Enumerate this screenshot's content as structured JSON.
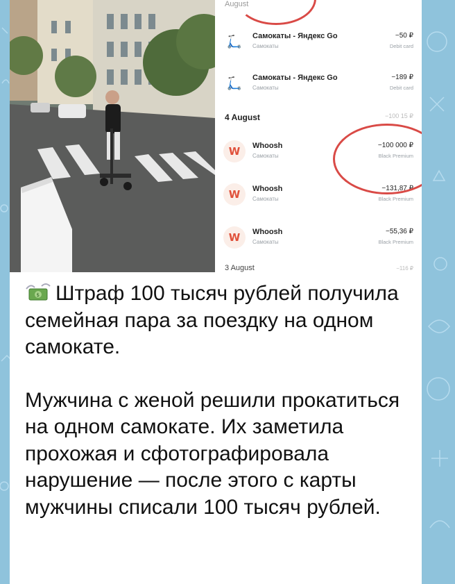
{
  "transactions_screenshot": {
    "header_faded": "August",
    "rows": [
      {
        "merchant": "Самокаты - Яндекс Go",
        "category": "Самокаты",
        "amount": "−50 ₽",
        "card": "Debit card",
        "logo": "yandex-scooter-icon"
      },
      {
        "merchant": "Самокаты - Яндекс Go",
        "category": "Самокаты",
        "amount": "−189 ₽",
        "card": "Debit card",
        "logo": "yandex-scooter-icon"
      }
    ],
    "date_group": "4 August",
    "date_group_right_faded": "−100 15 ₽",
    "whoosh_rows": [
      {
        "merchant": "Whoosh",
        "category": "Самокаты",
        "amount": "−100 000 ₽",
        "card": "Black Premium",
        "logo": "whoosh-logo-icon"
      },
      {
        "merchant": "Whoosh",
        "category": "Самокаты",
        "amount": "−131,87 ₽",
        "card": "Black Premium",
        "logo": "whoosh-logo-icon"
      },
      {
        "merchant": "Whoosh",
        "category": "Самокаты",
        "amount": "−55,36 ₽",
        "card": "Black Premium",
        "logo": "whoosh-logo-icon"
      }
    ],
    "next_date": "3 August",
    "next_amount": "−116 ₽"
  },
  "message": {
    "emoji": "money-with-wings-icon",
    "paragraph1": "Штраф 100 тысяч рублей получила семейная пара за поездку на одном самокате.",
    "paragraph2": "Мужчина с женой решили прокатиться на одном самокате. Их заметила прохожая и сфотографировала нарушение — после этого с карты мужчины списали 100 тысяч рублей."
  },
  "colors": {
    "chat_background": "#8fc3dc",
    "annotation_red": "#d94a46",
    "whoosh_accent": "#e0513b"
  }
}
